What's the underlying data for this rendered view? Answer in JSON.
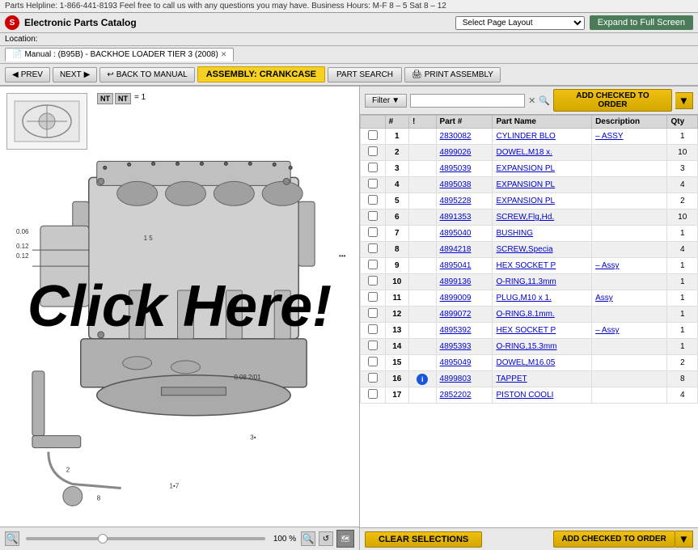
{
  "topbar": {
    "helpline": "Parts Helpline: 1-866-441-8193 Feel free to call us with any questions you may have. Business Hours: M-F 8 – 5 Sat 8 – 12"
  },
  "header": {
    "logo_text": "S",
    "title": "Electronic Parts Catalog",
    "page_layout_label": "Select Page Layout",
    "expand_button": "Expand to Full Screen"
  },
  "location": {
    "label": "Location:"
  },
  "tab": {
    "label": "Manual : (B95B) - BACKHOE LOADER TIER 3 (2008)"
  },
  "toolbar": {
    "prev_label": "PREV",
    "next_label": "NEXT",
    "back_label": "BACK TO MANUAL",
    "assembly_label": "ASSEMBLY: CRANKCASE",
    "part_search_label": "PART SEARCH",
    "print_label": "PRINT ASSEMBLY"
  },
  "filter": {
    "label": "Filter",
    "placeholder": "",
    "add_order_label": "ADD CHECKED TO ORDER"
  },
  "table": {
    "columns": [
      "",
      "#",
      "!",
      "Part #",
      "Part Name",
      "Description",
      "Qty"
    ],
    "rows": [
      {
        "num": "1",
        "alert": "",
        "part_num": "2830082",
        "part_name": "CYLINDER BLO",
        "description": "– ASSY",
        "qty": "1"
      },
      {
        "num": "2",
        "alert": "",
        "part_num": "4899026",
        "part_name": "DOWEL,M18 x.",
        "description": "",
        "qty": "10"
      },
      {
        "num": "3",
        "alert": "",
        "part_num": "4895039",
        "part_name": "EXPANSION PL",
        "description": "",
        "qty": "3"
      },
      {
        "num": "4",
        "alert": "",
        "part_num": "4895038",
        "part_name": "EXPANSION PL",
        "description": "",
        "qty": "4"
      },
      {
        "num": "5",
        "alert": "",
        "part_num": "4895228",
        "part_name": "EXPANSION PL",
        "description": "",
        "qty": "2"
      },
      {
        "num": "6",
        "alert": "",
        "part_num": "4891353",
        "part_name": "SCREW,Flg,Hd.",
        "description": "",
        "qty": "10"
      },
      {
        "num": "7",
        "alert": "",
        "part_num": "4895040",
        "part_name": "BUSHING",
        "description": "",
        "qty": "1"
      },
      {
        "num": "8",
        "alert": "",
        "part_num": "4894218",
        "part_name": "SCREW,Specia",
        "description": "",
        "qty": "4"
      },
      {
        "num": "9",
        "alert": "",
        "part_num": "4895041",
        "part_name": "HEX SOCKET P",
        "description": "– Assy",
        "qty": "1"
      },
      {
        "num": "10",
        "alert": "",
        "part_num": "4899136",
        "part_name": "O-RING,11.3mm",
        "description": "",
        "qty": "1"
      },
      {
        "num": "11",
        "alert": "",
        "part_num": "4899009",
        "part_name": "PLUG,M10 x 1.",
        "description": "Assy",
        "qty": "1"
      },
      {
        "num": "12",
        "alert": "",
        "part_num": "4899072",
        "part_name": "O-RING,8.1mm.",
        "description": "",
        "qty": "1"
      },
      {
        "num": "13",
        "alert": "",
        "part_num": "4895392",
        "part_name": "HEX SOCKET P",
        "description": "– Assy",
        "qty": "1"
      },
      {
        "num": "14",
        "alert": "",
        "part_num": "4895393",
        "part_name": "O-RING,15.3mm",
        "description": "",
        "qty": "1"
      },
      {
        "num": "15",
        "alert": "",
        "part_num": "4895049",
        "part_name": "DOWEL,M16.05",
        "description": "",
        "qty": "2"
      },
      {
        "num": "16",
        "alert": "info",
        "part_num": "4899803",
        "part_name": "TAPPET",
        "description": "",
        "qty": "8"
      },
      {
        "num": "17",
        "alert": "",
        "part_num": "2852202",
        "part_name": "PISTON COOLI",
        "description": "",
        "qty": "4"
      }
    ]
  },
  "zoom": {
    "percent": "100 %"
  },
  "bottom": {
    "clear_label": "CLEAR SELECTIONS",
    "add_order_label": "ADD CHECKED TO ORDER"
  },
  "overlay": {
    "click_here": "Click Here!"
  }
}
